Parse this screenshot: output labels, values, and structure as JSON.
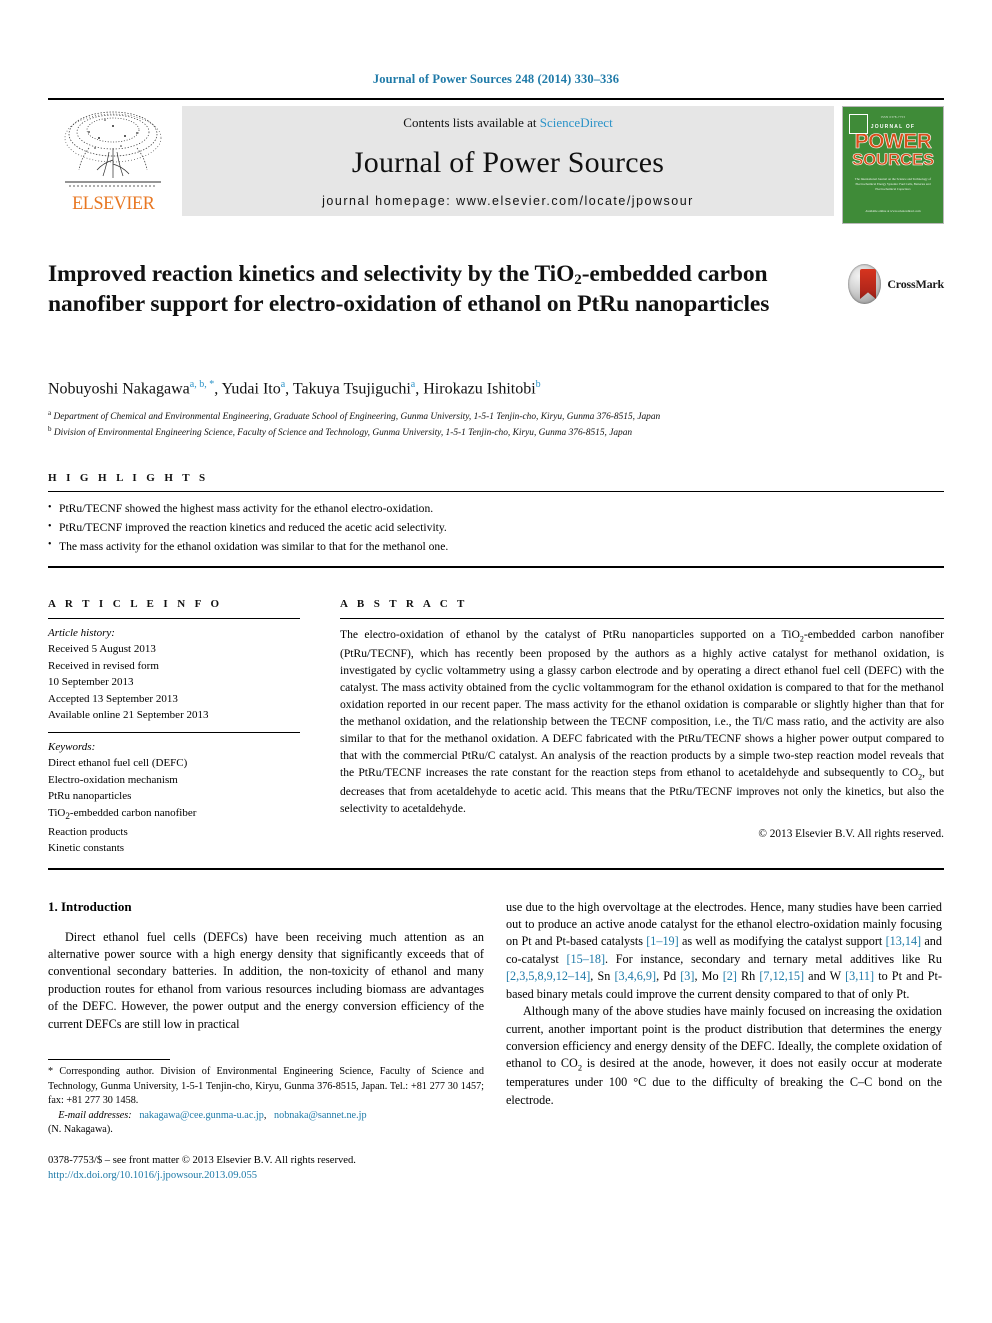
{
  "running_head": "Journal of Power Sources 248 (2014) 330–336",
  "masthead": {
    "publisher_name": "ELSEVIER",
    "contents_prefix": "Contents lists available at ",
    "contents_link": "ScienceDirect",
    "journal_title": "Journal of Power Sources",
    "homepage": "journal homepage: www.elsevier.com/locate/jpowsour",
    "cover": {
      "top_text": "ISSN 0378-7753",
      "journal_of": "JOURNAL OF",
      "power": "POWER",
      "sources": "SOURCES",
      "blurb": "The International Journal on the Science and Technology of Electrochemical Energy Systems: Fuel Cells, Batteries and Electrochemical Capacitors",
      "bottom": "Available online at www.sciencedirect.com"
    }
  },
  "article": {
    "title_part1": "Improved reaction kinetics and selectivity by the TiO",
    "title_sub": "2",
    "title_part2": "-embedded carbon nanofiber support for electro-oxidation of ethanol on PtRu nanoparticles",
    "crossmark_label": "CrossMark",
    "authors": [
      {
        "name": "Nobuyoshi Nakagawa",
        "marks": "a, b, *"
      },
      {
        "name": "Yudai Ito",
        "marks": "a"
      },
      {
        "name": "Takuya Tsujiguchi",
        "marks": "a"
      },
      {
        "name": "Hirokazu Ishitobi",
        "marks": "b"
      }
    ],
    "affiliations": [
      {
        "mark": "a",
        "text": "Department of Chemical and Environmental Engineering, Graduate School of Engineering, Gunma University, 1-5-1 Tenjin-cho, Kiryu, Gunma 376-8515, Japan"
      },
      {
        "mark": "b",
        "text": "Division of Environmental Engineering Science, Faculty of Science and Technology, Gunma University, 1-5-1 Tenjin-cho, Kiryu, Gunma 376-8515, Japan"
      }
    ]
  },
  "highlights": {
    "heading": "H I G H L I G H T S",
    "items": [
      "PtRu/TECNF showed the highest mass activity for the ethanol electro-oxidation.",
      "PtRu/TECNF improved the reaction kinetics and reduced the acetic acid selectivity.",
      "The mass activity for the ethanol oxidation was similar to that for the methanol one."
    ]
  },
  "article_info": {
    "heading": "A R T I C L E   I N F O",
    "history_label": "Article history:",
    "history": [
      "Received 5 August 2013",
      "Received in revised form",
      "10 September 2013",
      "Accepted 13 September 2013",
      "Available online 21 September 2013"
    ],
    "keywords_label": "Keywords:",
    "keywords_plain": [
      "Direct ethanol fuel cell (DEFC)",
      "Electro-oxidation mechanism",
      "PtRu nanoparticles"
    ],
    "keyword_tio2_pre": "TiO",
    "keyword_tio2_sub": "2",
    "keyword_tio2_post": "-embedded carbon nanofiber",
    "keywords_plain2": [
      "Reaction products",
      "Kinetic constants"
    ]
  },
  "abstract": {
    "heading": "A B S T R A C T",
    "p1": "The electro-oxidation of ethanol by the catalyst of PtRu nanoparticles supported on a TiO",
    "p1_sub": "2",
    "p2": "-embedded carbon nanofiber (PtRu/TECNF), which has recently been proposed by the authors as a highly active catalyst for methanol oxidation, is investigated by cyclic voltammetry using a glassy carbon electrode and by operating a direct ethanol fuel cell (DEFC) with the catalyst. The mass activity obtained from the cyclic voltammogram for the ethanol oxidation is compared to that for the methanol oxidation reported in our recent paper. The mass activity for the ethanol oxidation is comparable or slightly higher than that for the methanol oxidation, and the relationship between the TECNF composition, i.e., the Ti/C mass ratio, and the activity are also similar to that for the methanol oxidation. A DEFC fabricated with the PtRu/TECNF shows a higher power output compared to that with the commercial PtRu/C catalyst. An analysis of the reaction products by a simple two-step reaction model reveals that the PtRu/TECNF increases the rate constant for the reaction steps from ethanol to acetaldehyde and subsequently to CO",
    "p2_sub": "2",
    "p3": ", but decreases that from acetaldehyde to acetic acid. This means that the PtRu/TECNF improves not only the kinetics, but also the selectivity to acetaldehyde.",
    "copyright": "© 2013 Elsevier B.V. All rights reserved."
  },
  "introduction": {
    "heading": "1.  Introduction",
    "left_p1": "Direct ethanol fuel cells (DEFCs) have been receiving much attention as an alternative power source with a high energy density that significantly exceeds that of conventional secondary batteries. In addition, the non-toxicity of ethanol and many production routes for ethanol from various resources including biomass are advantages of the DEFC. However, the power output and the energy conversion efficiency of the current DEFCs are still low in practical",
    "right_p1_a": "use due to the high overvoltage at the electrodes. Hence, many studies have been carried out to produce an active anode catalyst for the ethanol electro-oxidation mainly focusing on Pt and Pt-based catalysts ",
    "right_ref1": "[1–19]",
    "right_p1_b": " as well as modifying the catalyst support ",
    "right_ref2": "[13,14]",
    "right_p1_c": " and co-catalyst ",
    "right_ref3": "[15–18]",
    "right_p1_d": ". For instance, secondary and ternary metal additives like Ru ",
    "right_ref4": "[2,3,5,8,9,12–14]",
    "right_p1_e": ", Sn ",
    "right_ref5": "[3,4,6,9]",
    "right_p1_f": ", Pd ",
    "right_ref6": "[3]",
    "right_p1_g": ", Mo ",
    "right_ref7": "[2]",
    "right_p1_h": " Rh ",
    "right_ref8": "[7,12,15]",
    "right_p1_i": " and W ",
    "right_ref9": "[3,11]",
    "right_p1_j": " to Pt and Pt-based binary metals could improve the current density compared to that of only Pt.",
    "right_p2_a": "Although many of the above studies have mainly focused on increasing the oxidation current, another important point is the product distribution that determines the energy conversion efficiency and energy density of the DEFC. Ideally, the complete oxidation of ethanol to CO",
    "right_p2_sub": "2",
    "right_p2_b": " is desired at the anode, however, it does not easily occur at moderate temperatures under 100 °C due to the difficulty of breaking the C–C bond on the electrode."
  },
  "footnote": {
    "corresponding": "* Corresponding author. Division of Environmental Engineering Science, Faculty of Science and Technology, Gunma University, 1-5-1 Tenjin-cho, Kiryu, Gunma 376-8515, Japan. Tel.: +81 277 30 1457; fax: +81 277 30 1458.",
    "email_label": "E-mail addresses:",
    "email1": "nakagawa@cee.gunma-u.ac.jp",
    "email2": "nobnaka@sannet.ne.jp",
    "email_suffix": "(N. Nakagawa)."
  },
  "imprint": {
    "line1": "0378-7753/$ – see front matter © 2013 Elsevier B.V. All rights reserved.",
    "doi": "http://dx.doi.org/10.1016/j.jpowsour.2013.09.055"
  },
  "colors": {
    "link": "#1f7aa8",
    "sciencedirect": "#2b93c8",
    "elsevier_orange": "#e87722",
    "cover_green": "#3f8b38"
  }
}
